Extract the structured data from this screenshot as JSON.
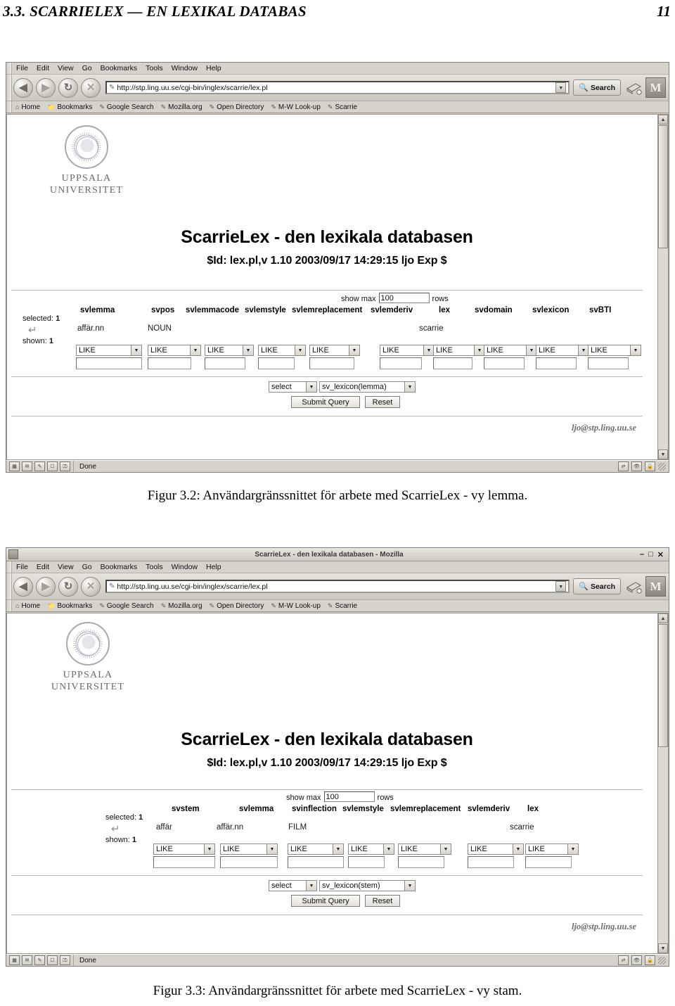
{
  "running_head": {
    "section": "3.3.  SCARRIELEX — EN LEXIKAL DATABAS",
    "page_number": "11"
  },
  "browser_chrome": {
    "menu_items": [
      "File",
      "Edit",
      "View",
      "Go",
      "Bookmarks",
      "Tools",
      "Window",
      "Help"
    ],
    "nav_buttons": [
      "back-button",
      "forward-button",
      "reload-button",
      "stop-button"
    ],
    "url": "http://stp.ling.uu.se/cgi-bin/inglex/scarrie/lex.pl",
    "search_label": "Search",
    "mozilla_logo_glyph": "M",
    "bookmarks": [
      "Home",
      "Bookmarks",
      "Google Search",
      "Mozilla.org",
      "Open Directory",
      "M-W Look-up",
      "Scarrie"
    ],
    "status_text": "Done",
    "window_buttons": [
      "minimize",
      "maximize",
      "close"
    ]
  },
  "page_body": {
    "logo_line1": "UPPSALA",
    "logo_line2": "UNIVERSITET",
    "heading": "ScarrieLex - den lexikala databasen",
    "version_id": "$Id: lex.pl,v 1.10 2003/09/17 14:29:15 ljo Exp $",
    "show_max_label": "show max",
    "show_max_value": "100",
    "rows_label": "rows",
    "selected_label": "selected:",
    "selected_count": "1",
    "shown_label": "shown:",
    "shown_count": "1",
    "operator_label": "LIKE",
    "action_label": "select",
    "submit_label": "Submit Query",
    "reset_label": "Reset",
    "email": "ljo@stp.ling.uu.se"
  },
  "figure_lemma": {
    "window_title": "ScarrieLex - den lexikala databasen - Mozilla",
    "table_label": "sv_lexicon(lemma)",
    "columns": [
      {
        "name": "svlemma",
        "value": "affär.nn"
      },
      {
        "name": "svpos",
        "value": "NOUN"
      },
      {
        "name": "svlemmacode",
        "value": ""
      },
      {
        "name": "svlemstyle",
        "value": ""
      },
      {
        "name": "svlemreplacement",
        "value": ""
      },
      {
        "name": "svlemderiv",
        "value": ""
      },
      {
        "name": "lex",
        "value": "scarrie"
      },
      {
        "name": "svdomain",
        "value": ""
      },
      {
        "name": "svlexicon",
        "value": ""
      },
      {
        "name": "svBTI",
        "value": ""
      }
    ],
    "caption": "Figur 3.2: Användargränssnittet för arbete med ScarrieLex - vy lemma."
  },
  "figure_stem": {
    "window_title": "ScarrieLex - den lexikala databasen - Mozilla",
    "table_label": "sv_lexicon(stem)",
    "columns": [
      {
        "name": "svstem",
        "value": "affär"
      },
      {
        "name": "svlemma",
        "value": "affär.nn"
      },
      {
        "name": "svinflection",
        "value": "FILM"
      },
      {
        "name": "svlemstyle",
        "value": ""
      },
      {
        "name": "svlemreplacement",
        "value": ""
      },
      {
        "name": "svlemderiv",
        "value": ""
      },
      {
        "name": "lex",
        "value": "scarrie"
      }
    ],
    "caption": "Figur 3.3: Användargränssnittet för arbete med ScarrieLex - vy stam."
  }
}
